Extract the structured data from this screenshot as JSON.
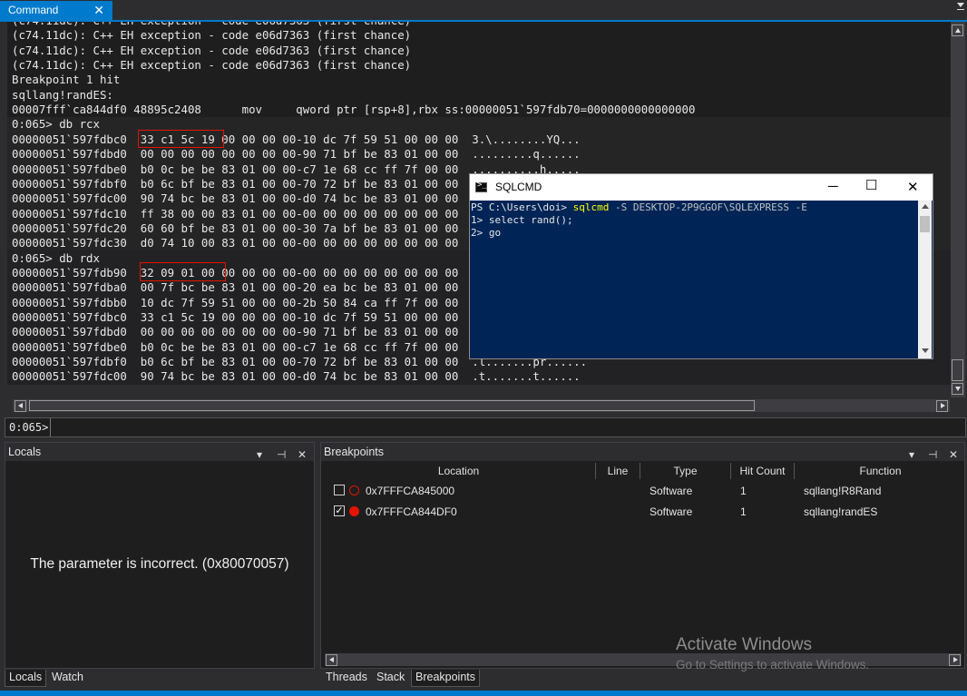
{
  "command_window": {
    "tab_label": "Command",
    "tab_close": "✕",
    "output_lines": [
      "(c74.11dc): C++ EH exception - code e06d7363 (first chance)",
      "(c74.11dc): C++ EH exception - code e06d7363 (first chance)",
      "(c74.11dc): C++ EH exception - code e06d7363 (first chance)",
      "(c74.11dc): C++ EH exception - code e06d7363 (first chance)",
      "Breakpoint 1 hit",
      "sqllang!randES:",
      "00007fff`ca844df0 48895c2408      mov     qword ptr [rsp+8],rbx ss:00000051`597fdb70=0000000000000000",
      "0:065> db rcx",
      "00000051`597fdbc0  33 c1 5c 19 00 00 00 00-10 dc 7f 59 51 00 00 00  3.\\........YQ...",
      "00000051`597fdbd0  00 00 00 00 00 00 00 00-90 71 bf be 83 01 00 00  .........q......",
      "00000051`597fdbe0  b0 0c be be 83 01 00 00-c7 1e 68 cc ff 7f 00 00  ..........h.....",
      "00000051`597fdbf0  b0 6c bf be 83 01 00 00-70 72 bf be 83 01 00 00",
      "00000051`597fdc00  90 74 bc be 83 01 00 00-d0 74 bc be 83 01 00 00",
      "00000051`597fdc10  ff 38 00 00 83 01 00 00-00 00 00 00 00 00 00 00",
      "00000051`597fdc20  60 60 bf be 83 01 00 00-30 7a bf be 83 01 00 00",
      "00000051`597fdc30  d0 74 10 00 83 01 00 00-00 00 00 00 00 00 00 00",
      "0:065> db rdx",
      "00000051`597fdb90  32 09 01 00 00 00 00 00-00 00 00 00 00 00 00 00",
      "00000051`597fdba0  00 7f bc be 83 01 00 00-20 ea bc be 83 01 00 00",
      "00000051`597fdbb0  10 dc 7f 59 51 00 00 00-2b 50 84 ca ff 7f 00 00",
      "00000051`597fdbc0  33 c1 5c 19 00 00 00 00-10 dc 7f 59 51 00 00 00",
      "00000051`597fdbd0  00 00 00 00 00 00 00 00-90 71 bf be 83 01 00 00",
      "00000051`597fdbe0  b0 0c be be 83 01 00 00-c7 1e 68 cc ff 7f 00 00",
      "00000051`597fdbf0  b0 6c bf be 83 01 00 00-70 72 bf be 83 01 00 00  .l.......pr......",
      "00000051`597fdc00  90 74 bc be 83 01 00 00-d0 74 bc be 83 01 00 00  .t.......t......"
    ],
    "prompt": "0:065>"
  },
  "locals_panel": {
    "title": "Locals",
    "message": "The parameter is incorrect. (0x80070057)"
  },
  "breakpoints_panel": {
    "title": "Breakpoints",
    "columns": [
      "Location",
      "Line",
      "Type",
      "Hit Count",
      "Function"
    ],
    "rows": [
      {
        "checked": false,
        "enabled": false,
        "location": "0x7FFFCA845000",
        "line": "",
        "type": "Software",
        "hit_count": "1",
        "function": "sqllang!R8Rand"
      },
      {
        "checked": true,
        "enabled": true,
        "location": "0x7FFFCA844DF0",
        "line": "",
        "type": "Software",
        "hit_count": "1",
        "function": "sqllang!randES"
      }
    ]
  },
  "bottom_tabs_left": [
    "Locals",
    "Watch"
  ],
  "bottom_tabs_right": [
    "Threads",
    "Stack",
    "Breakpoints"
  ],
  "sqlcmd_window": {
    "title": "SQLCMD",
    "icon_glyph": ">_",
    "line1": {
      "prompt": "PS C:\\Users\\doi> ",
      "command": "sqlcmd",
      "args": " -S DESKTOP-2P9GGOF\\SQLEXPRESS -E"
    },
    "line2": "1> select rand();",
    "line3": "2> go",
    "minimize": "─",
    "maximize": "☐",
    "close": "✕"
  },
  "watermark": {
    "line1": "Activate Windows",
    "line2": "Go to Settings to activate Windows."
  },
  "colors": {
    "accent": "#007acc",
    "highlight_box": "#e51400",
    "console_bg": "#012456",
    "sql_keyword": "#ffff00"
  },
  "icons": {
    "panel_menu": "chevron-down-icon",
    "panel_pin": "pin-icon",
    "panel_close": "close-icon",
    "bp_enabled": "breakpoint-filled-icon",
    "bp_disabled": "breakpoint-hollow-icon"
  }
}
